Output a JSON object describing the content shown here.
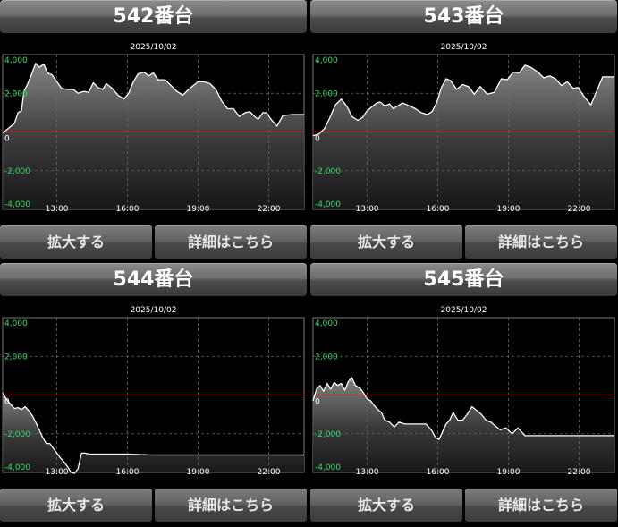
{
  "panels": [
    {
      "title": "542番台",
      "expand_label": "拡大する",
      "detail_label": "詳細はこちら",
      "chart_data": {
        "type": "area",
        "date": "2025/10/02",
        "x_ticks": [
          "13:00",
          "16:00",
          "19:00",
          "22:00"
        ],
        "y_ticks": [
          4000,
          2000,
          0,
          -2000,
          -4000
        ],
        "y_tick_labels": [
          "4,000",
          "2,000",
          "0",
          "-2,000",
          "-4,000"
        ],
        "ylim": [
          -4000,
          4000
        ],
        "xlim": [
          10.7,
          23.5
        ],
        "x": [
          10.7,
          10.95,
          11.2,
          11.35,
          11.5,
          11.6,
          11.75,
          11.9,
          12.1,
          12.25,
          12.45,
          12.6,
          12.8,
          13.0,
          13.2,
          13.45,
          13.7,
          13.9,
          14.15,
          14.35,
          14.55,
          14.75,
          14.95,
          15.1,
          15.35,
          15.6,
          15.85,
          16.05,
          16.25,
          16.45,
          16.7,
          16.9,
          17.1,
          17.3,
          17.6,
          17.85,
          18.1,
          18.35,
          18.6,
          19.0,
          19.25,
          19.5,
          19.75,
          20.0,
          20.25,
          20.5,
          20.75,
          21.0,
          21.2,
          21.4,
          21.55,
          21.75,
          21.9,
          22.1,
          22.35,
          22.6,
          23.0,
          23.5
        ],
        "y": [
          -50,
          200,
          450,
          1000,
          1100,
          2100,
          2450,
          2900,
          3550,
          3350,
          3500,
          3050,
          2950,
          2600,
          2250,
          2200,
          2200,
          2000,
          2100,
          2050,
          2550,
          2300,
          2200,
          2500,
          2250,
          1900,
          1700,
          2000,
          2600,
          3000,
          3100,
          2900,
          3050,
          2700,
          2700,
          2400,
          2100,
          1900,
          2200,
          2600,
          2600,
          2500,
          2200,
          1600,
          1200,
          1200,
          800,
          1000,
          1050,
          800,
          650,
          1000,
          1000,
          650,
          300,
          850,
          900,
          900
        ]
      }
    },
    {
      "title": "543番台",
      "expand_label": "拡大する",
      "detail_label": "詳細はこちら",
      "chart_data": {
        "type": "area",
        "date": "2025/10/02",
        "x_ticks": [
          "13:00",
          "16:00",
          "19:00",
          "22:00"
        ],
        "y_ticks": [
          4000,
          2000,
          0,
          -2000,
          -4000
        ],
        "y_tick_labels": [
          "4,000",
          "2,000",
          "0",
          "-2,000",
          "-4,000"
        ],
        "ylim": [
          -4000,
          4000
        ],
        "xlim": [
          10.7,
          23.5
        ],
        "x": [
          10.7,
          10.95,
          11.2,
          11.4,
          11.65,
          11.9,
          12.15,
          12.35,
          12.6,
          12.8,
          13.0,
          13.2,
          13.4,
          13.55,
          13.75,
          13.95,
          14.1,
          14.3,
          14.5,
          14.8,
          15.05,
          15.3,
          15.55,
          15.75,
          15.95,
          16.15,
          16.35,
          16.55,
          16.8,
          17.05,
          17.3,
          17.55,
          17.8,
          18.1,
          18.4,
          18.7,
          18.95,
          19.2,
          19.45,
          19.7,
          19.95,
          20.25,
          20.5,
          20.75,
          21.0,
          21.25,
          21.5,
          21.75,
          21.95,
          22.2,
          22.5,
          23.0,
          23.5
        ],
        "y": [
          -200,
          -100,
          200,
          700,
          1400,
          1700,
          1300,
          800,
          600,
          750,
          1100,
          1300,
          1500,
          1550,
          1350,
          1450,
          1200,
          1350,
          1500,
          1350,
          1200,
          1000,
          900,
          1050,
          1500,
          2300,
          2750,
          2650,
          2200,
          2450,
          2350,
          1950,
          2350,
          1950,
          2050,
          2750,
          2700,
          3100,
          3050,
          3450,
          3350,
          3100,
          2800,
          2900,
          2750,
          2400,
          2600,
          2250,
          2300,
          1850,
          1400,
          2850,
          2850
        ]
      }
    },
    {
      "title": "544番台",
      "expand_label": "拡大する",
      "detail_label": "詳細はこちら",
      "chart_data": {
        "type": "area",
        "date": "2025/10/02",
        "x_ticks": [
          "13:00",
          "16:00",
          "19:00",
          "22:00"
        ],
        "y_ticks": [
          4000,
          2000,
          0,
          -2000,
          -4000
        ],
        "y_tick_labels": [
          "4,000",
          "2,000",
          "0",
          "-2,000",
          "-4,000"
        ],
        "ylim": [
          -4000,
          4000
        ],
        "xlim": [
          10.7,
          23.5
        ],
        "x": [
          10.7,
          10.85,
          11.05,
          11.2,
          11.35,
          11.5,
          11.65,
          11.8,
          11.95,
          12.1,
          12.25,
          12.4,
          12.55,
          12.7,
          12.85,
          13.0,
          13.15,
          13.3,
          13.45,
          13.6,
          13.75,
          13.9,
          14.05,
          14.2,
          14.4,
          14.6,
          15.0,
          16.0,
          17.0,
          18.0,
          19.0,
          20.0,
          21.0,
          22.0,
          23.5
        ],
        "y": [
          100,
          -200,
          -500,
          -700,
          -650,
          -750,
          -600,
          -800,
          -1050,
          -1400,
          -1800,
          -2200,
          -2500,
          -2500,
          -2750,
          -3000,
          -3250,
          -3450,
          -3700,
          -4000,
          -4050,
          -3800,
          -3000,
          -3000,
          -3050,
          -3050,
          -3050,
          -3050,
          -3100,
          -3100,
          -3100,
          -3100,
          -3100,
          -3100,
          -3100
        ]
      }
    },
    {
      "title": "545番台",
      "expand_label": "拡大する",
      "detail_label": "詳細はこちら",
      "chart_data": {
        "type": "area",
        "date": "2025/10/02",
        "x_ticks": [
          "13:00",
          "16:00",
          "19:00",
          "22:00"
        ],
        "y_ticks": [
          4000,
          2000,
          0,
          -2000,
          -4000
        ],
        "y_tick_labels": [
          "4,000",
          "2,000",
          "0",
          "-2,000",
          "-4,000"
        ],
        "ylim": [
          -4000,
          4000
        ],
        "xlim": [
          10.7,
          23.5
        ],
        "x": [
          10.7,
          10.85,
          11.0,
          11.15,
          11.3,
          11.45,
          11.6,
          11.75,
          11.9,
          12.05,
          12.2,
          12.35,
          12.5,
          12.7,
          12.85,
          13.0,
          13.15,
          13.3,
          13.45,
          13.6,
          13.75,
          13.95,
          14.15,
          14.35,
          14.6,
          14.9,
          15.2,
          15.5,
          15.75,
          15.9,
          16.05,
          16.2,
          16.35,
          16.5,
          16.65,
          16.85,
          17.05,
          17.25,
          17.45,
          17.65,
          17.85,
          18.05,
          18.25,
          18.45,
          18.65,
          18.9,
          19.15,
          19.4,
          19.7,
          20.0,
          21.0,
          22.0,
          23.5
        ],
        "y": [
          -300,
          300,
          500,
          200,
          600,
          300,
          650,
          500,
          600,
          250,
          700,
          900,
          500,
          350,
          100,
          -200,
          -300,
          -550,
          -750,
          -900,
          -1300,
          -1400,
          -1650,
          -1400,
          -1500,
          -1500,
          -1500,
          -1500,
          -1850,
          -2200,
          -2300,
          -1900,
          -1500,
          -1300,
          -900,
          -1300,
          -1300,
          -1000,
          -600,
          -800,
          -1000,
          -1300,
          -1400,
          -1600,
          -1800,
          -1700,
          -2000,
          -1700,
          -2100,
          -2100,
          -2100,
          -2100,
          -2100
        ]
      }
    }
  ]
}
